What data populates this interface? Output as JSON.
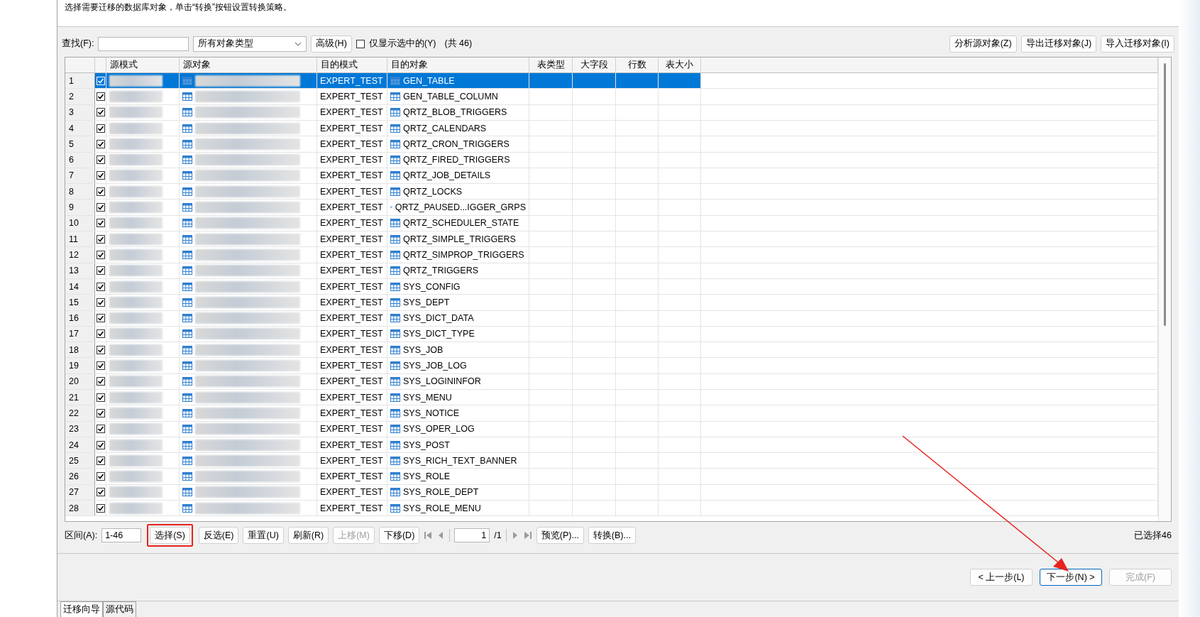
{
  "instruction": "选择需要迁移的数据库对象，单击“转换”按钮设置转换策略。",
  "toolbar": {
    "find_label": "查找(F):",
    "type_select": "所有对象类型",
    "advanced": "高级(H)",
    "only_selected": {
      "label": "仅显示选中的(Y)",
      "checked": false
    },
    "count": "(共 46)",
    "buttons": [
      "分析源对象(Z)",
      "导出迁移对象(J)",
      "导入迁移对象(I)"
    ]
  },
  "table": {
    "columns": [
      "源模式",
      "源对象",
      "目的模式",
      "目的对象",
      "表类型",
      "大字段",
      "行数",
      "表大小"
    ],
    "rows": [
      {
        "number": "1",
        "checked": true,
        "selected": true,
        "target_schema": "EXPERT_TEST",
        "target_object": "GEN_TABLE"
      },
      {
        "number": "2",
        "checked": true,
        "selected": false,
        "target_schema": "EXPERT_TEST",
        "target_object": "GEN_TABLE_COLUMN"
      },
      {
        "number": "3",
        "checked": true,
        "selected": false,
        "target_schema": "EXPERT_TEST",
        "target_object": "QRTZ_BLOB_TRIGGERS"
      },
      {
        "number": "4",
        "checked": true,
        "selected": false,
        "target_schema": "EXPERT_TEST",
        "target_object": "QRTZ_CALENDARS"
      },
      {
        "number": "5",
        "checked": true,
        "selected": false,
        "target_schema": "EXPERT_TEST",
        "target_object": "QRTZ_CRON_TRIGGERS"
      },
      {
        "number": "6",
        "checked": true,
        "selected": false,
        "target_schema": "EXPERT_TEST",
        "target_object": "QRTZ_FIRED_TRIGGERS"
      },
      {
        "number": "7",
        "checked": true,
        "selected": false,
        "target_schema": "EXPERT_TEST",
        "target_object": "QRTZ_JOB_DETAILS"
      },
      {
        "number": "8",
        "checked": true,
        "selected": false,
        "target_schema": "EXPERT_TEST",
        "target_object": "QRTZ_LOCKS"
      },
      {
        "number": "9",
        "checked": true,
        "selected": false,
        "target_schema": "EXPERT_TEST",
        "target_object": "QRTZ_PAUSED...IGGER_GRPS"
      },
      {
        "number": "10",
        "checked": true,
        "selected": false,
        "target_schema": "EXPERT_TEST",
        "target_object": "QRTZ_SCHEDULER_STATE"
      },
      {
        "number": "11",
        "checked": true,
        "selected": false,
        "target_schema": "EXPERT_TEST",
        "target_object": "QRTZ_SIMPLE_TRIGGERS"
      },
      {
        "number": "12",
        "checked": true,
        "selected": false,
        "target_schema": "EXPERT_TEST",
        "target_object": "QRTZ_SIMPROP_TRIGGERS"
      },
      {
        "number": "13",
        "checked": true,
        "selected": false,
        "target_schema": "EXPERT_TEST",
        "target_object": "QRTZ_TRIGGERS"
      },
      {
        "number": "14",
        "checked": true,
        "selected": false,
        "target_schema": "EXPERT_TEST",
        "target_object": "SYS_CONFIG"
      },
      {
        "number": "15",
        "checked": true,
        "selected": false,
        "target_schema": "EXPERT_TEST",
        "target_object": "SYS_DEPT"
      },
      {
        "number": "16",
        "checked": true,
        "selected": false,
        "target_schema": "EXPERT_TEST",
        "target_object": "SYS_DICT_DATA"
      },
      {
        "number": "17",
        "checked": true,
        "selected": false,
        "target_schema": "EXPERT_TEST",
        "target_object": "SYS_DICT_TYPE"
      },
      {
        "number": "18",
        "checked": true,
        "selected": false,
        "target_schema": "EXPERT_TEST",
        "target_object": "SYS_JOB"
      },
      {
        "number": "19",
        "checked": true,
        "selected": false,
        "target_schema": "EXPERT_TEST",
        "target_object": "SYS_JOB_LOG"
      },
      {
        "number": "20",
        "checked": true,
        "selected": false,
        "target_schema": "EXPERT_TEST",
        "target_object": "SYS_LOGININFOR"
      },
      {
        "number": "21",
        "checked": true,
        "selected": false,
        "target_schema": "EXPERT_TEST",
        "target_object": "SYS_MENU"
      },
      {
        "number": "22",
        "checked": true,
        "selected": false,
        "target_schema": "EXPERT_TEST",
        "target_object": "SYS_NOTICE"
      },
      {
        "number": "23",
        "checked": true,
        "selected": false,
        "target_schema": "EXPERT_TEST",
        "target_object": "SYS_OPER_LOG"
      },
      {
        "number": "24",
        "checked": true,
        "selected": false,
        "target_schema": "EXPERT_TEST",
        "target_object": "SYS_POST"
      },
      {
        "number": "25",
        "checked": true,
        "selected": false,
        "target_schema": "EXPERT_TEST",
        "target_object": "SYS_RICH_TEXT_BANNER"
      },
      {
        "number": "26",
        "checked": true,
        "selected": false,
        "target_schema": "EXPERT_TEST",
        "target_object": "SYS_ROLE"
      },
      {
        "number": "27",
        "checked": true,
        "selected": false,
        "target_schema": "EXPERT_TEST",
        "target_object": "SYS_ROLE_DEPT"
      },
      {
        "number": "28",
        "checked": true,
        "selected": false,
        "target_schema": "EXPERT_TEST",
        "target_object": "SYS_ROLE_MENU"
      }
    ]
  },
  "range": {
    "label": "区间(A):",
    "value": "1-46"
  },
  "actions": [
    {
      "label": "选择(S)",
      "disabled": false,
      "highlighted": true
    },
    {
      "label": "反选(E)",
      "disabled": false,
      "highlighted": false
    },
    {
      "label": "重置(U)",
      "disabled": false,
      "highlighted": false
    },
    {
      "label": "刷新(R)",
      "disabled": false,
      "highlighted": false
    },
    {
      "label": "上移(M)",
      "disabled": true,
      "highlighted": false
    },
    {
      "label": "下移(D)",
      "disabled": false,
      "highlighted": false
    }
  ],
  "pager": {
    "page": "1",
    "total": "/1"
  },
  "extra_actions": [
    "预览(P)...",
    "转换(B)..."
  ],
  "selected_count": "已选择46",
  "wizard_buttons": [
    {
      "label": "< 上一步(L)",
      "disabled": false,
      "default": false
    },
    {
      "label": "下一步(N) >",
      "disabled": false,
      "default": true
    },
    {
      "label": "完成(F)",
      "disabled": true,
      "default": false
    }
  ],
  "tabs": [
    {
      "label": "迁移向导",
      "selected": true
    },
    {
      "label": "源代码",
      "selected": false
    }
  ]
}
